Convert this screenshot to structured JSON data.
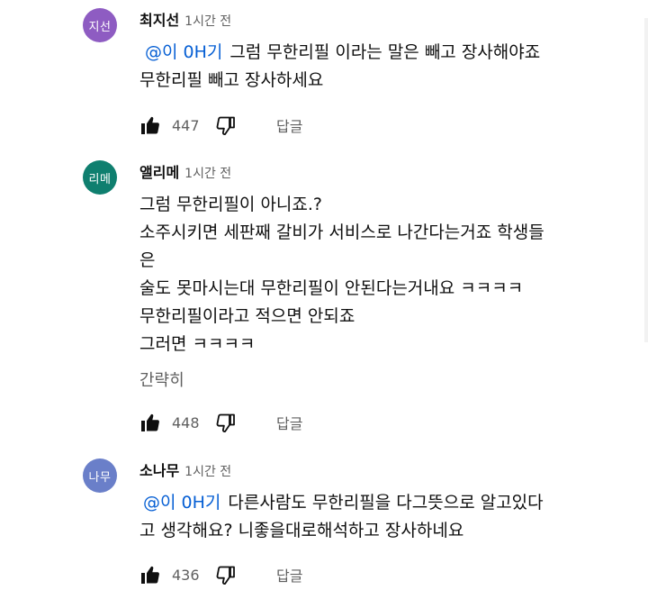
{
  "comments": [
    {
      "avatar_text": "지선",
      "avatar_color": "#8e5cc2",
      "author": "최지선",
      "time": "1시간 전",
      "mention": "@이 0H기",
      "lines": [
        "그럼 무한리필 이라는 말은 빼고 장사해야죠",
        "무한리필 빼고 장사하세요"
      ],
      "likes": "447",
      "reply_label": "답글"
    },
    {
      "avatar_text": "리메",
      "avatar_color": "#0f7f6f",
      "author": "앨리메",
      "time": "1시간 전",
      "lines": [
        "그럼 무한리필이 아니죠.?",
        "소주시키면 세판째 갈비가 서비스로 나간다는거죠 학생들",
        "은",
        "술도 못마시는대 무한리필이 안된다는거내요 ㅋㅋㅋㅋ",
        "무한리필이라고 적으면 안되죠",
        "그러면 ㅋㅋㅋㅋ"
      ],
      "more_label": "간략히",
      "likes": "448",
      "reply_label": "답글"
    },
    {
      "avatar_text": "나무",
      "avatar_color": "#6a7fc9",
      "author": "소나무",
      "time": "1시간 전",
      "mention": "@이 0H기",
      "lines": [
        "다른사람도 무한리필을 다그뜻으로 알고있다",
        "고 생각해요? 니좋을대로해석하고 장사하네요"
      ],
      "likes": "436",
      "reply_label": "답글"
    }
  ],
  "icons": {
    "like": "thumbs-up-icon",
    "dislike": "thumbs-down-icon"
  }
}
